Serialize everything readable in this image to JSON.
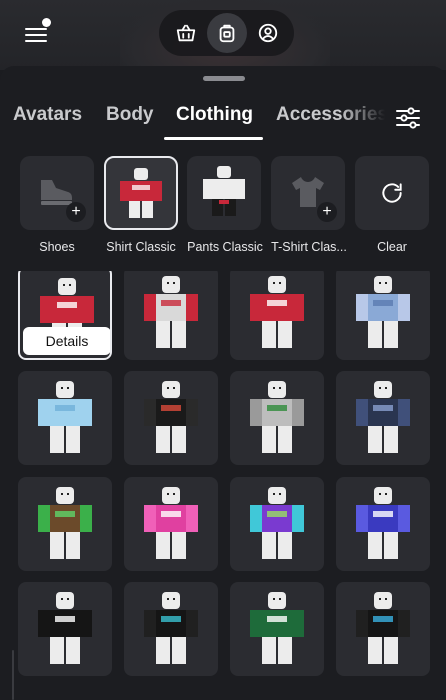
{
  "nav": {
    "items": [
      {
        "name": "shop-bag-icon"
      },
      {
        "name": "avatar-backpack-icon",
        "active": true
      },
      {
        "name": "profile-icon"
      }
    ]
  },
  "tabs": [
    {
      "label": "Avatars"
    },
    {
      "label": "Body"
    },
    {
      "label": "Clothing",
      "active": true
    },
    {
      "label": "Accessories"
    }
  ],
  "categories": [
    {
      "label": "Shoes",
      "icon": "shoe-icon",
      "add": true
    },
    {
      "label": "Shirt Classic",
      "icon": "shirt-thumbnail",
      "selected": true
    },
    {
      "label": "Pants Classic",
      "icon": "pants-thumbnail"
    },
    {
      "label": "T-Shirt Clas...",
      "icon": "tshirt-icon",
      "add": true
    },
    {
      "label": "Clear",
      "icon": "refresh-icon"
    }
  ],
  "items": [
    {
      "shirt": "#c8283a",
      "sleeve": "#c8283a",
      "accent": "#ffffff",
      "selected": true
    },
    {
      "shirt": "#d9d9d9",
      "sleeve": "#c8283a",
      "accent": "#c8283a"
    },
    {
      "shirt": "#c8283a",
      "sleeve": "#c8283a",
      "accent": "#ffffff"
    },
    {
      "shirt": "#8aa9d6",
      "sleeve": "#b8c8e8",
      "accent": "#5a7ab0"
    },
    {
      "shirt": "#9fd2ee",
      "sleeve": "#9fd2ee",
      "accent": "#6fb0d8"
    },
    {
      "shirt": "#1a1a1a",
      "sleeve": "#2a2a2a",
      "accent": "#d94a3a"
    },
    {
      "shirt": "#bdbdbd",
      "sleeve": "#9a9a9a",
      "accent": "#2e8b3a"
    },
    {
      "shirt": "#2a3550",
      "sleeve": "#40507a",
      "accent": "#8aa0d0"
    },
    {
      "shirt": "#6b4a2a",
      "sleeve": "#3bb04a",
      "accent": "#5fd46a"
    },
    {
      "shirt": "#e040a0",
      "sleeve": "#f060b8",
      "accent": "#ffffff"
    },
    {
      "shirt": "#7a3ad0",
      "sleeve": "#40c8d8",
      "accent": "#9ae060"
    },
    {
      "shirt": "#3a3ac0",
      "sleeve": "#5a5ae0",
      "accent": "#ffffff"
    },
    {
      "shirt": "#151515",
      "sleeve": "#151515",
      "accent": "#ffffff"
    },
    {
      "shirt": "#151515",
      "sleeve": "#202020",
      "accent": "#3ac0d0"
    },
    {
      "shirt": "#1e6b3a",
      "sleeve": "#1e6b3a",
      "accent": "#ffffff"
    },
    {
      "shirt": "#151515",
      "sleeve": "#202020",
      "accent": "#3ab0e0"
    }
  ],
  "details_label": "Details",
  "colors": {
    "background": "#1c1d21",
    "tile": "#2b2c31",
    "selected_border": "#e9eaee"
  }
}
